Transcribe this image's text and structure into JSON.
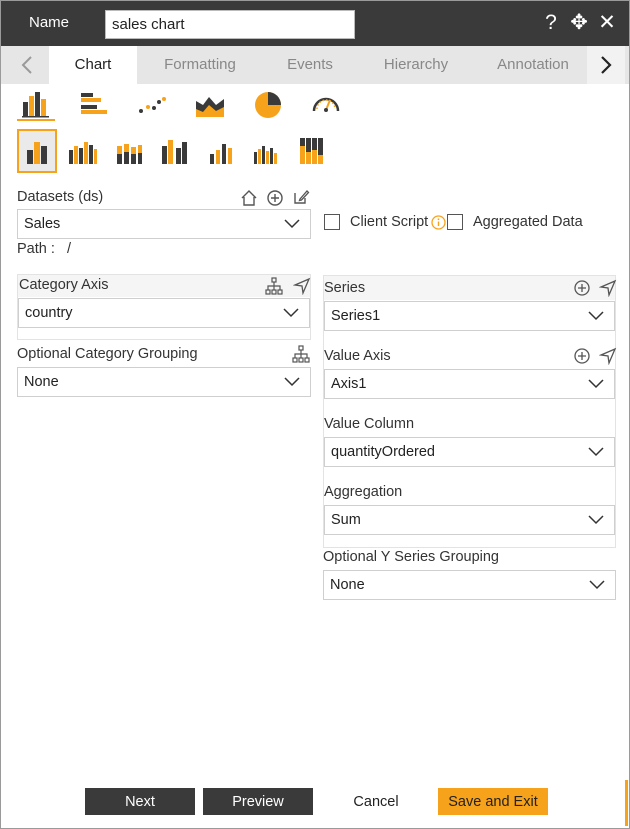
{
  "header": {
    "name_label": "Name",
    "name_value": "sales chart",
    "icons": [
      "help-icon",
      "move-icon",
      "close-icon"
    ]
  },
  "tabs": [
    {
      "label": "Chart",
      "active": true
    },
    {
      "label": "Formatting",
      "active": false
    },
    {
      "label": "Events",
      "active": false
    },
    {
      "label": "Hierarchy",
      "active": false
    },
    {
      "label": "Annotation",
      "active": false
    }
  ],
  "chart_types": [
    "column-chart-icon",
    "bar-chart-icon",
    "scatter-chart-icon",
    "area-chart-icon",
    "pie-chart-icon",
    "gauge-chart-icon"
  ],
  "chart_variants": [
    "clustered-column-icon",
    "grouped-column-icon",
    "stacked-column-icon",
    "multi-column-icon",
    "step-column-icon",
    "small-multi-column-icon",
    "full-stacked-column-icon"
  ],
  "datasets": {
    "label": "Datasets (ds)",
    "value": "Sales",
    "path_label": "Path :",
    "path_value": "/"
  },
  "options": {
    "client_script": "Client Script",
    "aggregated_data": "Aggregated Data"
  },
  "category_axis": {
    "label": "Category Axis",
    "value": "country"
  },
  "category_grouping": {
    "label": "Optional Category Grouping",
    "value": "None"
  },
  "series": {
    "label": "Series",
    "value": "Series1"
  },
  "value_axis": {
    "label": "Value Axis",
    "value": "Axis1"
  },
  "value_column": {
    "label": "Value Column",
    "value": "quantityOrdered"
  },
  "aggregation": {
    "label": "Aggregation",
    "value": "Sum"
  },
  "y_series_grouping": {
    "label": "Optional Y Series Grouping",
    "value": "None"
  },
  "footer": {
    "next": "Next",
    "preview": "Preview",
    "cancel": "Cancel",
    "save_exit": "Save and Exit"
  },
  "colors": {
    "accent": "#f7a21b",
    "dark": "#3a3a3a",
    "tab_bg": "#e6e6e6"
  }
}
